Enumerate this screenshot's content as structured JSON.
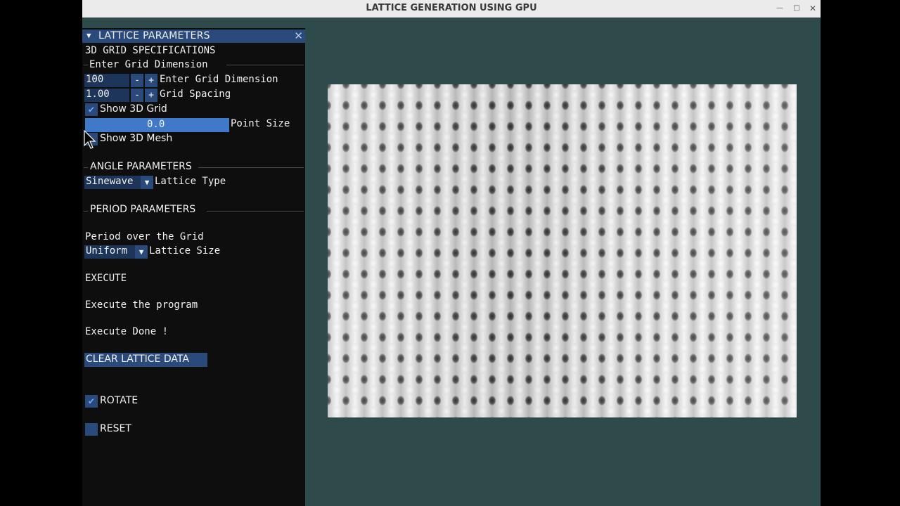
{
  "window": {
    "title": "LATTICE GENERATION USING GPU",
    "minimize_icon": "minimize-icon",
    "maximize_icon": "maximize-icon",
    "close_icon": "close-icon"
  },
  "panel": {
    "header": "LATTICE PARAMETERS",
    "section_grid": "3D GRID SPECIFICATIONS",
    "subsection_grid": "Enter Grid Dimension",
    "grid_dimension": {
      "value": "100",
      "label": "Enter Grid Dimension",
      "minus": "-",
      "plus": "+"
    },
    "grid_spacing": {
      "value": "1.00",
      "label": "Grid Spacing",
      "minus": "-",
      "plus": "+"
    },
    "show_grid": {
      "label": "Show 3D Grid",
      "checked": true
    },
    "point_size": {
      "value": "0.0",
      "label": "Point Size"
    },
    "show_mesh": {
      "label": "Show 3D Mesh",
      "checked": false
    },
    "section_angle": "ANGLE PARAMETERS",
    "lattice_type": {
      "value": "Sinewave",
      "label": "Lattice Type"
    },
    "section_period": "PERIOD PARAMETERS",
    "period_text": "Period over the Grid",
    "lattice_size": {
      "value": "Uniform",
      "label": "Lattice Size"
    },
    "execute_heading": "EXECUTE",
    "execute_text": "Execute the program",
    "execute_status": "Execute Done !",
    "clear_button": "CLEAR LATTICE DATA",
    "rotate": {
      "label": "ROTATE",
      "checked": true
    },
    "reset": {
      "label": "RESET",
      "checked": false
    }
  },
  "colors": {
    "viewport_bg": "#2f4a4a",
    "panel_bg": "#0e0e0e",
    "accent": "#294a7a",
    "slider": "#3f79c8"
  }
}
